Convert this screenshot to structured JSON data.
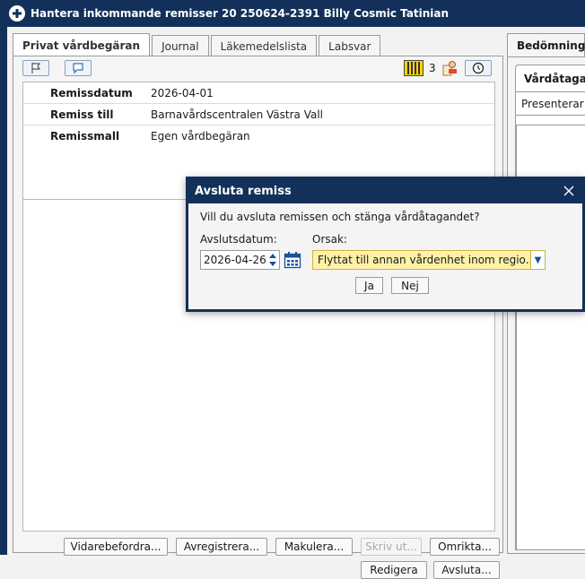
{
  "window": {
    "title": "Hantera inkommande remisser 20 250624-2391 Billy Cosmic Tatinian"
  },
  "left": {
    "tabs": [
      "Privat vårdbegäran",
      "Journal",
      "Läkemedelslista",
      "Labsvar"
    ],
    "toolbar": {
      "count": "3"
    },
    "rows": [
      {
        "label": "Remissdatum",
        "value": "2026-04-01"
      },
      {
        "label": "Remiss till",
        "value": "Barnavårdscentralen Västra Vall"
      },
      {
        "label": "Remissmall",
        "value": "Egen vårdbegäran"
      }
    ],
    "buttons": {
      "vidarebefordra": "Vidarebefordra...",
      "avregistrera": "Avregistrera...",
      "makulera": "Makulera...",
      "skriv_ut": "Skriv ut...",
      "omrikta": "Omrikta...",
      "redigera": "Redigera",
      "avsluta": "Avsluta..."
    }
  },
  "right": {
    "tab": "Bedömning",
    "inner_tab": "Vårdåtagan",
    "presenterar": "Presenterar"
  },
  "dialog": {
    "title": "Avsluta remiss",
    "question": "Vill du avsluta remissen och stänga vårdåtagandet?",
    "date_label": "Avslutsdatum:",
    "date_value": "2026-04-26",
    "reason_label": "Orsak:",
    "reason_value": "Flyttat till annan vårdenhet inom regio...",
    "yes": "Ja",
    "no": "Nej"
  },
  "colors": {
    "frame": "#13305a",
    "select_bg": "#fff2a8",
    "accent": "#1c4f99"
  },
  "icons": [
    "plus-circle-icon",
    "flag-icon",
    "comment-icon",
    "barcode-icon",
    "pharmacist-icon",
    "history-icon",
    "calendar-icon",
    "spinner-icon",
    "dropdown-arrow-icon",
    "close-icon"
  ]
}
